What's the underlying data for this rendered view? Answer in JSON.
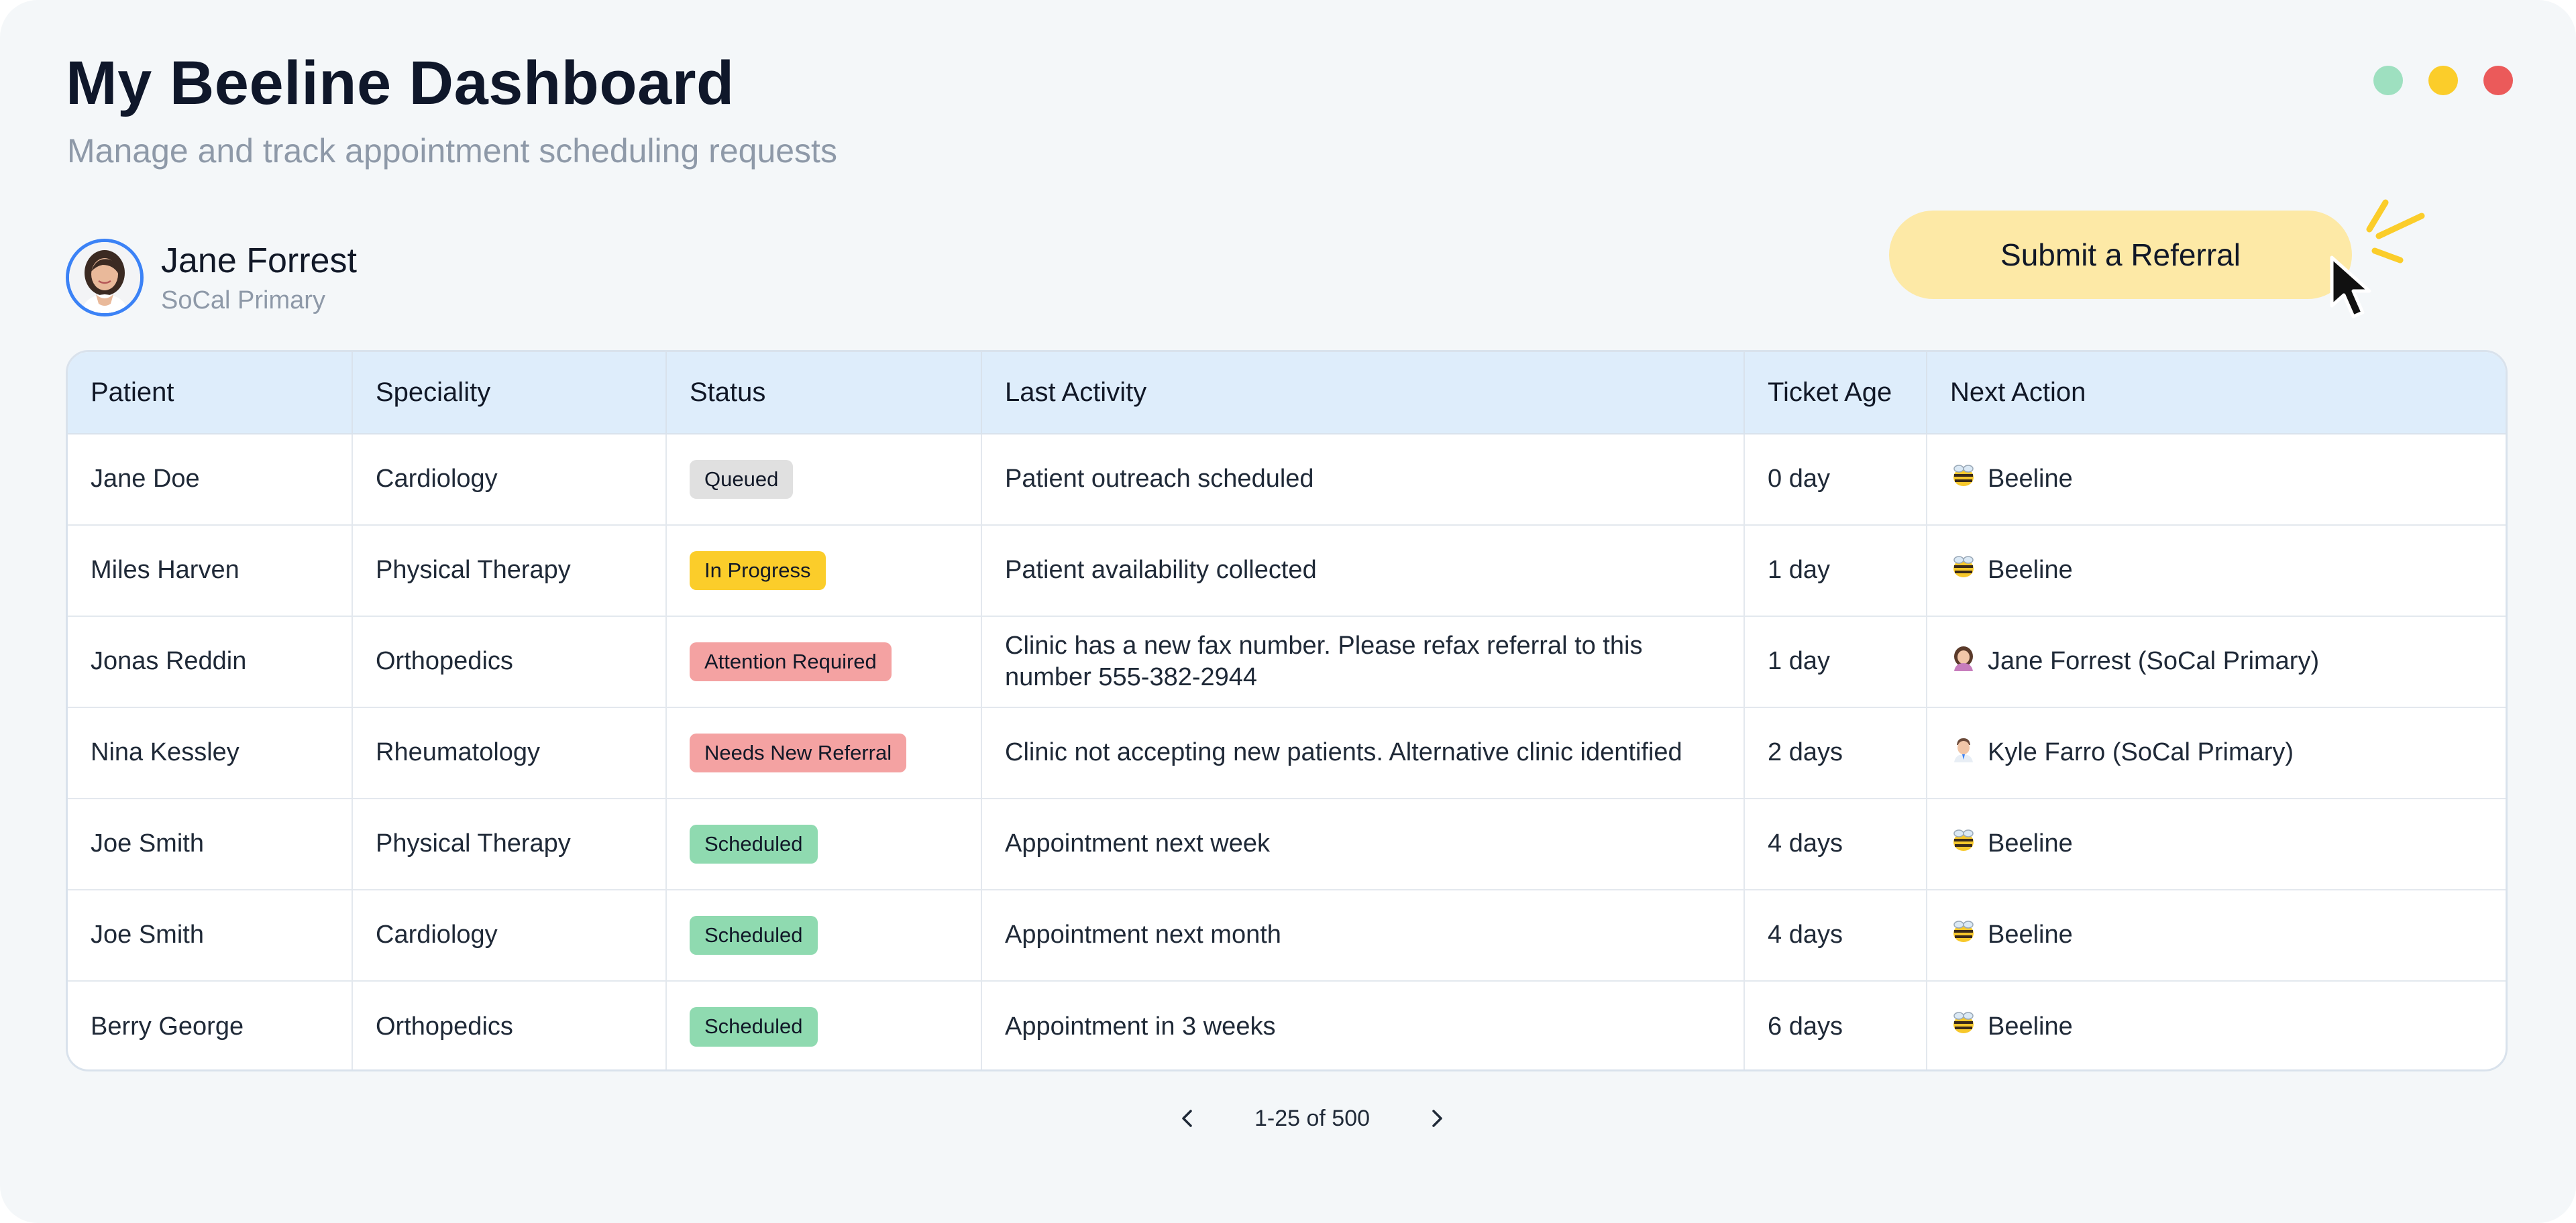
{
  "header": {
    "title": "My Beeline Dashboard",
    "subtitle": "Manage and track appointment scheduling requests"
  },
  "window_controls": {
    "colors": [
      "#9ee0c0",
      "#fbcd2a",
      "#eb5a5a"
    ]
  },
  "user": {
    "name": "Jane Forrest",
    "org": "SoCal Primary"
  },
  "submit_button": {
    "label": "Submit a Referral",
    "color": "#fde9a6"
  },
  "table": {
    "columns": [
      "Patient",
      "Speciality",
      "Status",
      "Last Activity",
      "Ticket Age",
      "Next Action"
    ],
    "rows": [
      {
        "patient": "Jane Doe",
        "speciality": "Cardiology",
        "status": "Queued",
        "status_kind": "queued",
        "last_activity": "Patient outreach scheduled",
        "ticket_age": "0 day",
        "next_action": "Beeline",
        "action_icon": "bee-icon"
      },
      {
        "patient": "Miles Harven",
        "speciality": "Physical Therapy",
        "status": "In Progress",
        "status_kind": "progress",
        "last_activity": "Patient availability collected",
        "ticket_age": "1 day",
        "next_action": "Beeline",
        "action_icon": "bee-icon"
      },
      {
        "patient": "Jonas Reddin",
        "speciality": "Orthopedics",
        "status": "Attention Required",
        "status_kind": "attention",
        "last_activity": "Clinic has a new fax number. Please refax referral to this number 555-382-2944",
        "ticket_age": "1 day",
        "next_action": "Jane Forrest (SoCal Primary)",
        "action_icon": "woman-icon"
      },
      {
        "patient": "Nina Kessley",
        "speciality": "Rheumatology",
        "status": "Needs New Referral",
        "status_kind": "referral",
        "last_activity": "Clinic not accepting new patients. Alternative clinic identified",
        "ticket_age": "2 days",
        "next_action": "Kyle Farro (SoCal Primary)",
        "action_icon": "man-icon"
      },
      {
        "patient": "Joe Smith",
        "speciality": "Physical Therapy",
        "status": "Scheduled",
        "status_kind": "scheduled",
        "last_activity": "Appointment next week",
        "ticket_age": "4 days",
        "next_action": "Beeline",
        "action_icon": "bee-icon"
      },
      {
        "patient": "Joe Smith",
        "speciality": "Cardiology",
        "status": "Scheduled",
        "status_kind": "scheduled",
        "last_activity": "Appointment next month",
        "ticket_age": "4 days",
        "next_action": "Beeline",
        "action_icon": "bee-icon"
      },
      {
        "patient": "Berry George",
        "speciality": "Orthopedics",
        "status": "Scheduled",
        "status_kind": "scheduled",
        "last_activity": "Appointment in 3 weeks",
        "ticket_age": "6 days",
        "next_action": "Beeline",
        "action_icon": "bee-icon"
      }
    ]
  },
  "pagination": {
    "label": "1-25 of 500"
  },
  "status_colors": {
    "queued": "#e0e0e0",
    "progress": "#fbcd2a",
    "attention": "#f4a2a2",
    "referral": "#f4a2a2",
    "scheduled": "#8fdab0"
  }
}
